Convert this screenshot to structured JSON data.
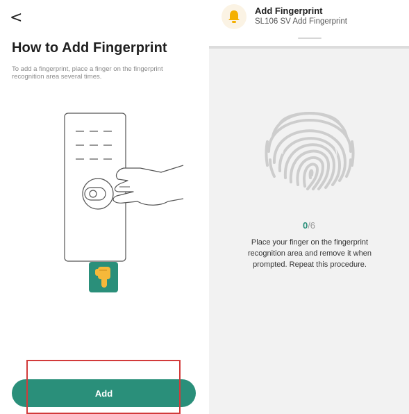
{
  "left_panel": {
    "back_glyph": "<",
    "title": "How to Add Fingerprint",
    "description": "To add a fingerprint, place a finger on the fingerprint recognition area several times.",
    "add_button_label": "Add",
    "accent_color": "#2a8f7a",
    "highlight_color": "#d23a3a"
  },
  "notification": {
    "icon": "bell-icon",
    "title": "Add Fingerprint",
    "subtitle": "SL106 SV Add Fingerprint"
  },
  "enroll_sheet": {
    "progress_current": "0",
    "progress_total": "/6",
    "instructions": "Place your finger on the fingerprint recognition area and remove it when prompted. Repeat this procedure."
  }
}
